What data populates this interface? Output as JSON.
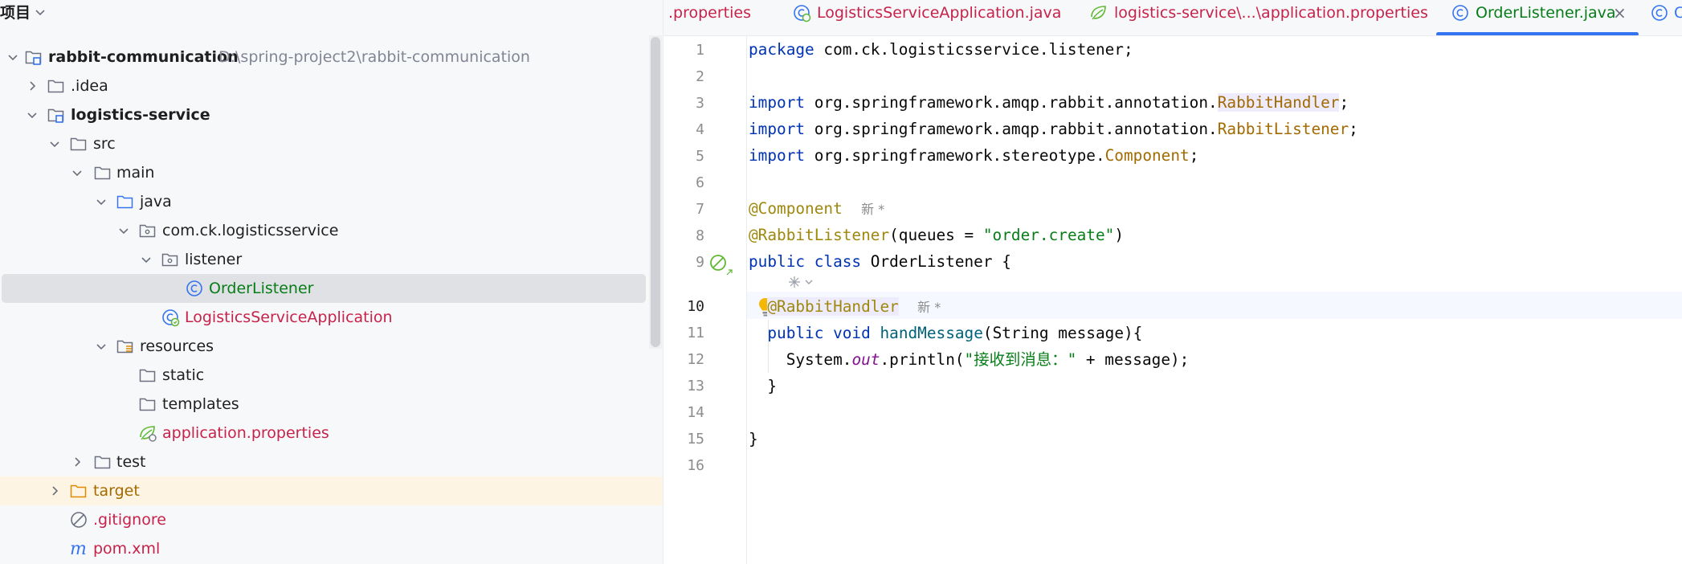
{
  "project": {
    "header_title": "项目",
    "tree": [
      {
        "label": "rabbit-communication",
        "path": "D:\\spring-project2\\rabbit-communication"
      },
      {
        "label": ".idea"
      },
      {
        "label": "logistics-service"
      },
      {
        "label": "src"
      },
      {
        "label": "main"
      },
      {
        "label": "java"
      },
      {
        "label": "com.ck.logisticsservice"
      },
      {
        "label": "listener"
      },
      {
        "label": "OrderListener"
      },
      {
        "label": "LogisticsServiceApplication"
      },
      {
        "label": "resources"
      },
      {
        "label": "static"
      },
      {
        "label": "templates"
      },
      {
        "label": "application.properties"
      },
      {
        "label": "test"
      },
      {
        "label": "target"
      },
      {
        "label": ".gitignore"
      },
      {
        "label": "pom.xml"
      }
    ]
  },
  "editor": {
    "tabs": [
      {
        "label": ".properties"
      },
      {
        "label": "LogisticsServiceApplication.java"
      },
      {
        "label": "logistics-service\\...\\application.properties"
      },
      {
        "label": "OrderListener.java",
        "close": "×"
      },
      {
        "label": "C"
      }
    ],
    "line_numbers": [
      "1",
      "2",
      "3",
      "4",
      "5",
      "6",
      "7",
      "8",
      "9",
      "10",
      "11",
      "12",
      "13",
      "14",
      "15",
      "16"
    ],
    "code": {
      "l1_kw": "package",
      "l1_rest": " com.ck.logisticsservice.listener;",
      "imp": "import",
      "l3_pkg": " org.springframework.amqp.rabbit.annotation.",
      "l3_cls": "RabbitHandler",
      "semi": ";",
      "l4_pkg": " org.springframework.amqp.rabbit.annotation.",
      "l4_cls": "RabbitListener",
      "l5_pkg": " org.springframework.stereotype.",
      "l5_cls": "Component",
      "l7_ann": "@Component",
      "l8_ann": "@RabbitListener",
      "l8_open": "(queues = ",
      "l8_str": "\"order.create\"",
      "l8_close": ")",
      "l9_kw": "public class",
      "l9_rest": " OrderListener {",
      "l10_ann": "@RabbitHandler",
      "l11_kw": "public void",
      "l11_fn": "handMessage",
      "l11_rest": "(String message){",
      "l12_a": "System.",
      "l12_fld": "out",
      "l12_b": ".println(",
      "l12_str": "\"接收到消息：\"",
      "l12_c": " + message);",
      "l13": "}",
      "l15": "}",
      "hint_new": "新 *"
    }
  },
  "colors": {
    "accent": "#3574f0",
    "keyword": "#0033b3",
    "annotation": "#9e880d",
    "string": "#067d17",
    "class_ref": "#a36a00"
  }
}
